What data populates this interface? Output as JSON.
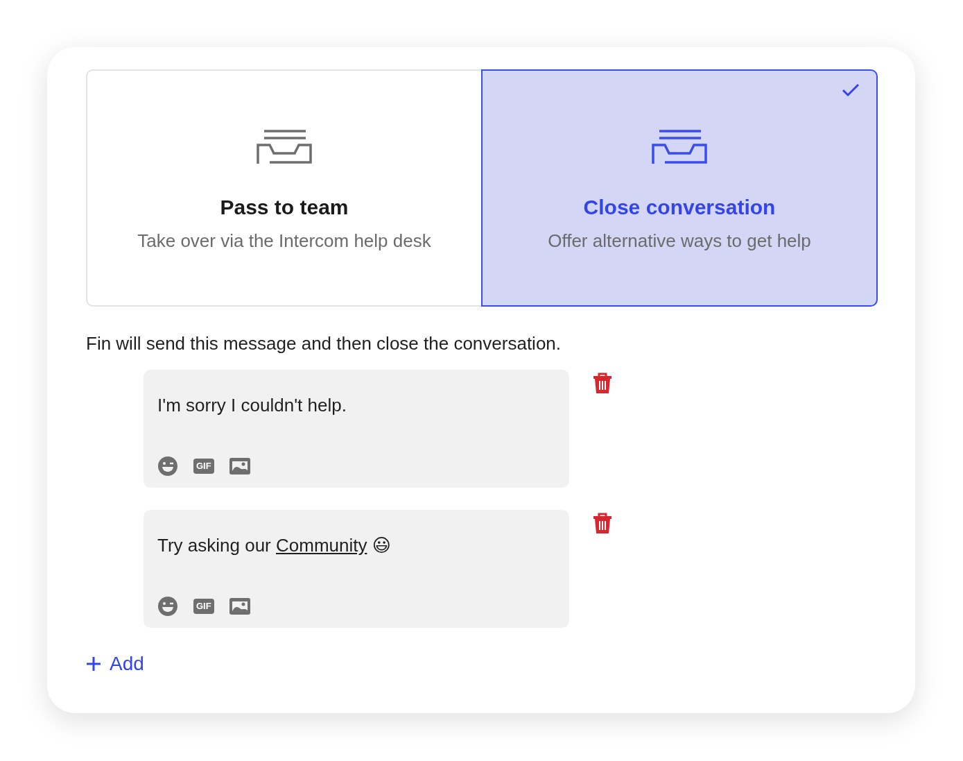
{
  "options": [
    {
      "title": "Pass to team",
      "subtitle": "Take over via the Intercom help desk",
      "selected": false
    },
    {
      "title": "Close conversation",
      "subtitle": "Offer alternative ways to get help",
      "selected": true
    }
  ],
  "description": "Fin will send this message and then close the conversation.",
  "messages": [
    {
      "parts": [
        {
          "kind": "text",
          "text": "I'm sorry I couldn't help."
        }
      ],
      "gif_label": "GIF"
    },
    {
      "parts": [
        {
          "kind": "text",
          "text": "Try asking our "
        },
        {
          "kind": "link",
          "text": "Community"
        },
        {
          "kind": "text",
          "text": " 😃"
        }
      ],
      "gif_label": "GIF"
    }
  ],
  "add_button": {
    "label": "Add"
  }
}
